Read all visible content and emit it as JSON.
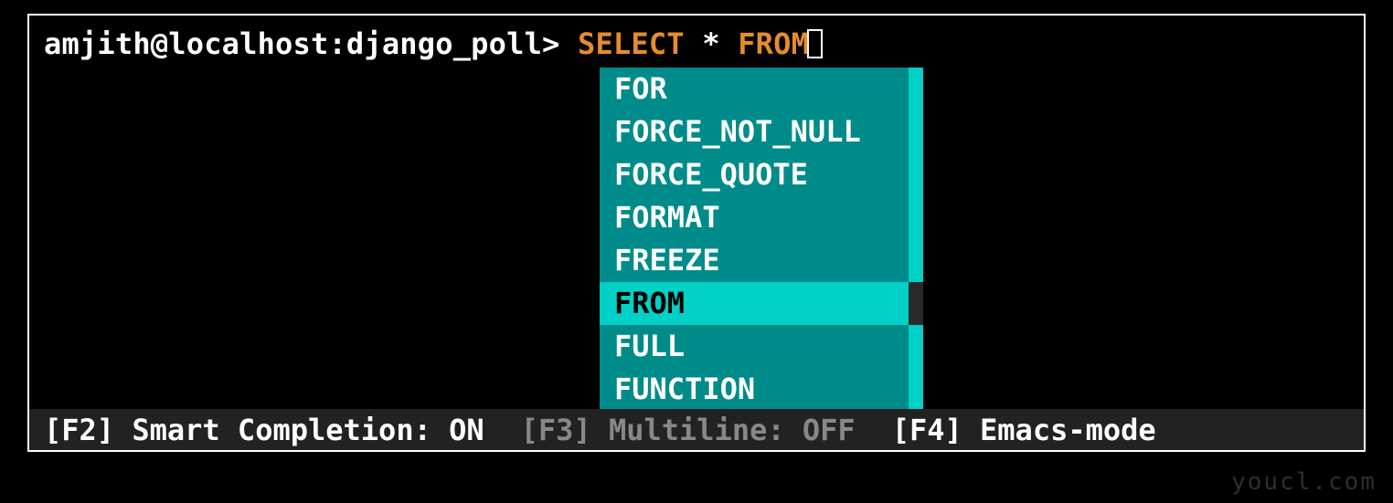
{
  "prompt": {
    "user_host_db": "amjith@localhost:django_poll>",
    "sql_select": "SELECT",
    "sql_star": "*",
    "sql_from": "FROM"
  },
  "completions": {
    "items": [
      {
        "label": "FOR",
        "selected": false
      },
      {
        "label": "FORCE_NOT_NULL",
        "selected": false
      },
      {
        "label": "FORCE_QUOTE",
        "selected": false
      },
      {
        "label": "FORMAT",
        "selected": false
      },
      {
        "label": "FREEZE",
        "selected": false
      },
      {
        "label": "FROM",
        "selected": true
      },
      {
        "label": "FULL",
        "selected": false
      },
      {
        "label": "FUNCTION",
        "selected": false
      }
    ]
  },
  "status": {
    "f2": "[F2] Smart Completion: ON",
    "f3": "[F3] Multiline: OFF",
    "f4": "[F4] Emacs-mode"
  },
  "watermark": "youcl.com"
}
